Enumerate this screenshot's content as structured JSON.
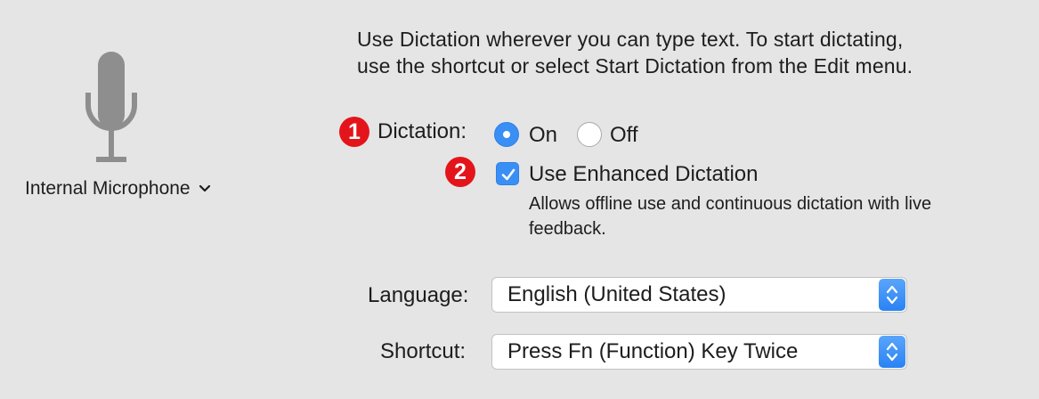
{
  "colors": {
    "background": "#e5e5e5",
    "accent": "#3a8ff5",
    "badge": "#e3151b",
    "icon_gray": "#8e8e8e"
  },
  "microphone": {
    "icon": "microphone-icon",
    "source_label": "Internal Microphone",
    "dropdown_icon": "chevron-down-icon"
  },
  "intro": {
    "line1": "Use Dictation wherever you can type text. To start dictating,",
    "line2": "use the shortcut or select Start Dictation from the Edit menu."
  },
  "callouts": [
    "1",
    "2"
  ],
  "dictation": {
    "label": "Dictation:",
    "options": [
      {
        "label": "On",
        "selected": true
      },
      {
        "label": "Off",
        "selected": false
      }
    ]
  },
  "enhanced": {
    "checked": true,
    "label": "Use Enhanced Dictation",
    "description_line1": "Allows offline use and continuous dictation with live",
    "description_line2": "feedback."
  },
  "language": {
    "label": "Language:",
    "value": "English (United States)"
  },
  "shortcut": {
    "label": "Shortcut:",
    "value": "Press Fn (Function) Key Twice"
  }
}
